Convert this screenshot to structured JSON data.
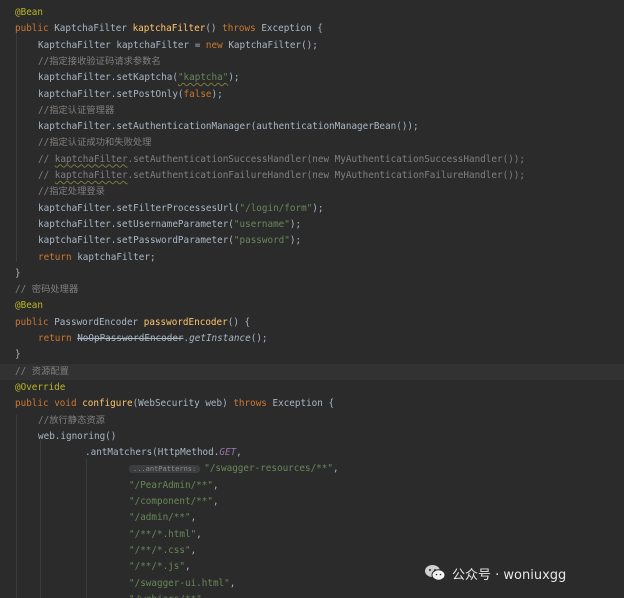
{
  "code_lines": [
    [
      {
        "t": "@Bean",
        "c": "ann"
      }
    ],
    [
      {
        "t": "public ",
        "c": "kw"
      },
      {
        "t": "KaptchaFilter "
      },
      {
        "t": "kaptchaFilter",
        "c": "fn"
      },
      {
        "t": "() "
      },
      {
        "t": "throws ",
        "c": "kw"
      },
      {
        "t": "Exception {"
      }
    ],
    [
      {
        "t": "KaptchaFilter kaptchaFilter = "
      },
      {
        "t": "new ",
        "c": "kw"
      },
      {
        "t": "KaptchaFilter();"
      }
    ],
    [
      {
        "t": "//指定接收验证码请求参数名",
        "c": "cmt"
      }
    ],
    [
      {
        "t": "kaptchaFilter.setKaptcha("
      },
      {
        "t": "\"kaptcha\"",
        "c": "str squig"
      },
      {
        "t": ");"
      }
    ],
    [
      {
        "t": "kaptchaFilter.setPostOnly("
      },
      {
        "t": "false",
        "c": "kw"
      },
      {
        "t": ");"
      }
    ],
    [
      {
        "t": "//指定认证管理器",
        "c": "cmt"
      }
    ],
    [
      {
        "t": "kaptchaFilter.setAuthenticationManager(authenticationManagerBean());"
      }
    ],
    [
      {
        "t": "//指定认证成功和失败处理",
        "c": "cmt"
      }
    ],
    [
      {
        "t": "// ",
        "c": "cmt"
      },
      {
        "t": "kaptchaFilter",
        "c": "cmt squig"
      },
      {
        "t": ".setAuthenticationSuccessHandler(new MyAuthenticationSuccessHandler());",
        "c": "cmt"
      }
    ],
    [
      {
        "t": "// ",
        "c": "cmt"
      },
      {
        "t": "kaptchaFilter",
        "c": "cmt squig"
      },
      {
        "t": ".setAuthenticationFailureHandler(new MyAuthenticationFailureHandler());",
        "c": "cmt"
      }
    ],
    [
      {
        "t": "//指定处理登录",
        "c": "cmt"
      }
    ],
    [
      {
        "t": "kaptchaFilter.setFilterProcessesUrl("
      },
      {
        "t": "\"/login/form\"",
        "c": "str"
      },
      {
        "t": ");"
      }
    ],
    [
      {
        "t": "kaptchaFilter.setUsernameParameter("
      },
      {
        "t": "\"username\"",
        "c": "str"
      },
      {
        "t": ");"
      }
    ],
    [
      {
        "t": "kaptchaFilter.setPasswordParameter("
      },
      {
        "t": "\"password\"",
        "c": "str"
      },
      {
        "t": ");"
      }
    ],
    [
      {
        "t": "return ",
        "c": "kw"
      },
      {
        "t": "kaptchaFilter;"
      }
    ],
    [
      {
        "t": "}"
      }
    ],
    [
      {
        "t": "// 密码处理器",
        "c": "cmt"
      }
    ],
    [
      {
        "t": "@Bean",
        "c": "ann"
      }
    ],
    [
      {
        "t": "public ",
        "c": "kw"
      },
      {
        "t": "PasswordEncoder "
      },
      {
        "t": "passwordEncoder",
        "c": "fn"
      },
      {
        "t": "() {"
      }
    ],
    [
      {
        "t": "return ",
        "c": "kw"
      },
      {
        "t": "NoOpPasswordEncoder",
        "c": "strike"
      },
      {
        "t": "."
      },
      {
        "t": "getInstance",
        "c": "st"
      },
      {
        "t": "();"
      }
    ],
    [
      {
        "t": "}"
      }
    ],
    [
      {
        "t": "// 资源配置",
        "c": "cmt"
      }
    ],
    [
      {
        "t": "@Override",
        "c": "ann"
      }
    ],
    [
      {
        "t": "public ",
        "c": "kw"
      },
      {
        "t": "void ",
        "c": "kw"
      },
      {
        "t": "configure",
        "c": "fn"
      },
      {
        "t": "(WebSecurity web) "
      },
      {
        "t": "throws ",
        "c": "kw"
      },
      {
        "t": "Exception {"
      }
    ],
    [
      {
        "t": "//放行静态资源",
        "c": "cmt"
      }
    ],
    [
      {
        "t": "web.ignoring()"
      }
    ],
    [
      {
        "t": ".antMatchers(HttpMethod."
      },
      {
        "t": "GET",
        "c": "it"
      },
      {
        "t": ","
      }
    ],
    [
      {
        "t": "...antPatterns:",
        "c": "hint"
      },
      {
        "t": "\"/swagger-resources/**\"",
        "c": "str"
      },
      {
        "t": ","
      }
    ],
    [
      {
        "t": "\"/PearAdmin/**\"",
        "c": "str"
      },
      {
        "t": ","
      }
    ],
    [
      {
        "t": "\"/component/**\"",
        "c": "str"
      },
      {
        "t": ","
      }
    ],
    [
      {
        "t": "\"/admin/**\"",
        "c": "str"
      },
      {
        "t": ","
      }
    ],
    [
      {
        "t": "\"/**/*.html\"",
        "c": "str"
      },
      {
        "t": ","
      }
    ],
    [
      {
        "t": "\"/**/*.css\"",
        "c": "str"
      },
      {
        "t": ","
      }
    ],
    [
      {
        "t": "\"/**/*.js\"",
        "c": "str"
      },
      {
        "t": ","
      }
    ],
    [
      {
        "t": "\"/swagger-ui.html\"",
        "c": "str"
      },
      {
        "t": ","
      }
    ],
    [
      {
        "t": "\"/webjars/**\"",
        "c": "str"
      },
      {
        "t": ","
      }
    ]
  ],
  "watermark": {
    "label": "公众号 · woniuxgg",
    "icon": "wechat-icon"
  }
}
